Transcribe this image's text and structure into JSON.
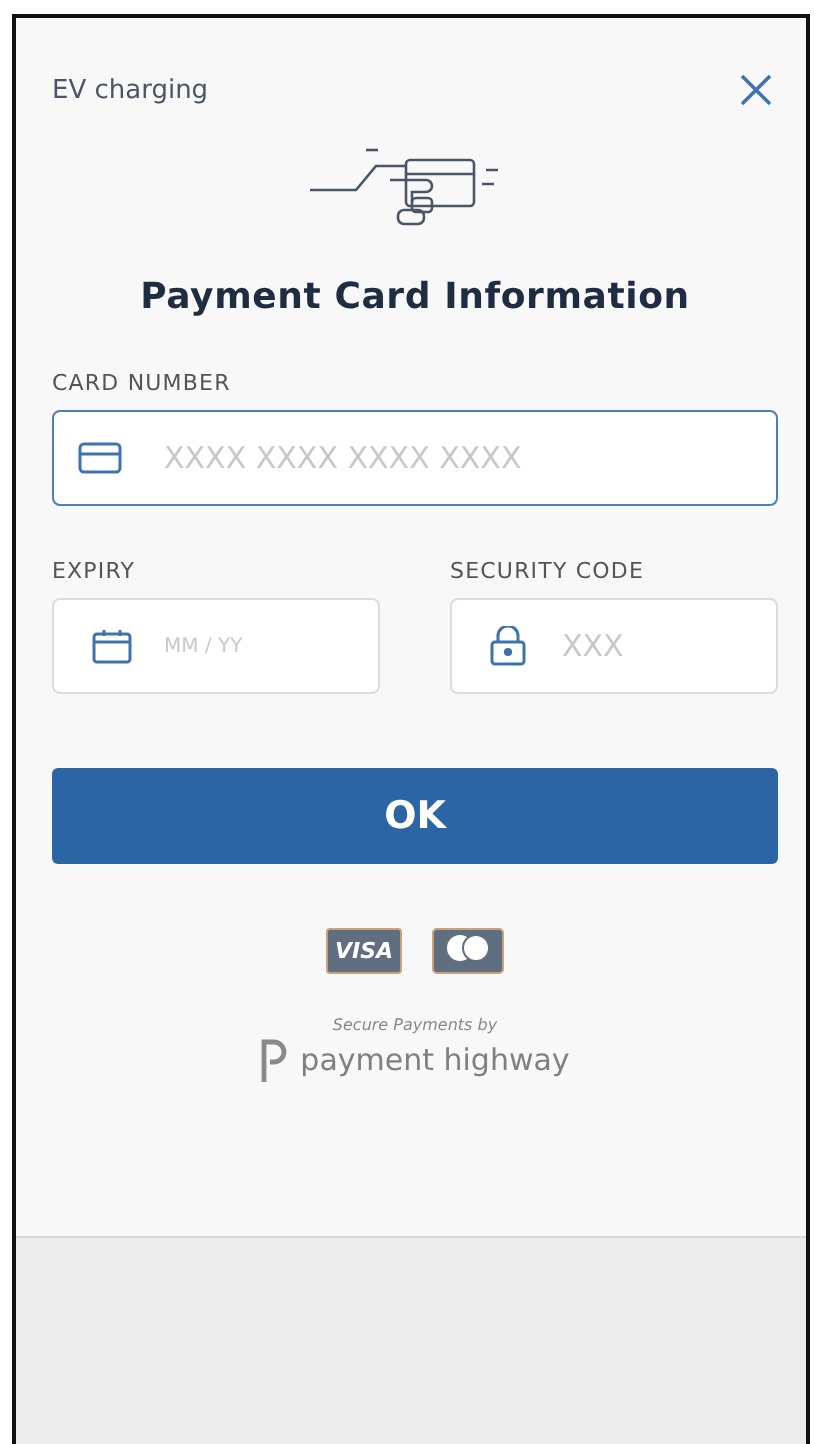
{
  "header": {
    "title": "EV charging"
  },
  "heading": "Payment Card Information",
  "card_number": {
    "label": "CARD NUMBER",
    "placeholder": "XXXX XXXX XXXX XXXX",
    "focused": true
  },
  "expiry": {
    "label": "EXPIRY",
    "placeholder": "MM / YY",
    "focused": false
  },
  "security_code": {
    "label": "SECURITY CODE",
    "placeholder": "XXX",
    "focused": false
  },
  "ok_button": "OK",
  "card_brands": [
    {
      "kind": "visa",
      "label": "VISA"
    },
    {
      "kind": "mastercard"
    }
  ],
  "footer": {
    "caption": "Secure Payments by",
    "brand": "payment highway"
  }
}
